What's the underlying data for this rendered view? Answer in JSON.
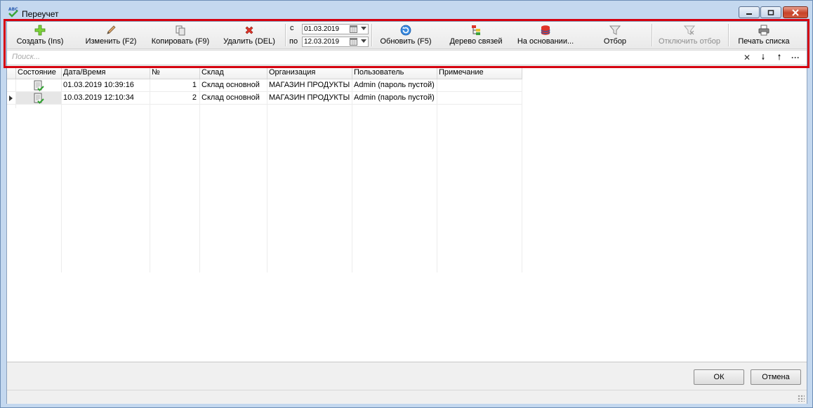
{
  "window": {
    "title": "Переучет",
    "icon": "abc-check-icon"
  },
  "toolbar": {
    "create_label": "Создать (Ins)",
    "edit_label": "Изменить (F2)",
    "copy_label": "Копировать (F9)",
    "delete_label": "Удалить (DEL)",
    "refresh_label": "Обновить (F5)",
    "tree_label": "Дерево связей",
    "based_on_label": "На основании...",
    "filter_label": "Отбор",
    "disable_filter_label": "Отключить отбор",
    "print_label": "Печать списка"
  },
  "period": {
    "from_label": "с",
    "to_label": "по",
    "from_value": "01.03.2019",
    "to_value": "12.03.2019"
  },
  "search": {
    "placeholder": "Поиск..."
  },
  "grid": {
    "columns": [
      "Состояние",
      "Дата/Время",
      "№",
      "Склад",
      "Организация",
      "Пользователь",
      "Примечание"
    ],
    "rows": [
      {
        "state": "document-posted-icon",
        "datetime": "01.03.2019 10:39:16",
        "number": "1",
        "warehouse": "Склад основной",
        "organization": "МАГАЗИН ПРОДУКТЫ",
        "user": "Admin (пароль пустой)",
        "note": ""
      },
      {
        "state": "document-posted-icon",
        "datetime": "10.03.2019 12:10:34",
        "number": "2",
        "warehouse": "Склад основной",
        "organization": "МАГАЗИН ПРОДУКТЫ",
        "user": "Admin (пароль пустой)",
        "note": ""
      }
    ]
  },
  "footer": {
    "ok_label": "ОК",
    "cancel_label": "Отмена"
  },
  "colors": {
    "highlight": "#d6000f",
    "titlebar": "#c4d8ef",
    "close_button": "#c7432a"
  }
}
